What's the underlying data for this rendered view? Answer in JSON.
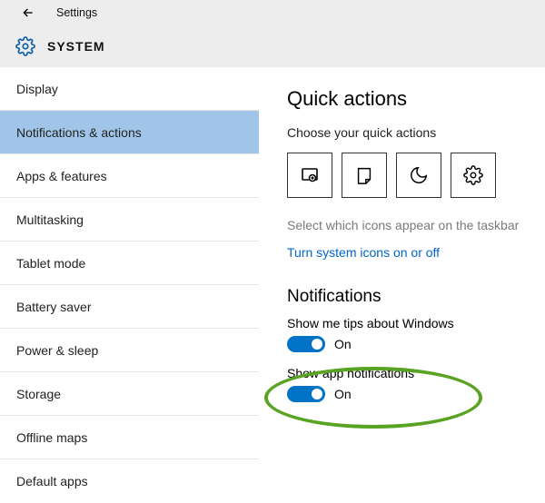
{
  "header": {
    "app_title": "Settings",
    "section_title": "SYSTEM"
  },
  "sidebar": {
    "items": [
      {
        "label": "Display",
        "selected": false
      },
      {
        "label": "Notifications & actions",
        "selected": true
      },
      {
        "label": "Apps & features",
        "selected": false
      },
      {
        "label": "Multitasking",
        "selected": false
      },
      {
        "label": "Tablet mode",
        "selected": false
      },
      {
        "label": "Battery saver",
        "selected": false
      },
      {
        "label": "Power & sleep",
        "selected": false
      },
      {
        "label": "Storage",
        "selected": false
      },
      {
        "label": "Offline maps",
        "selected": false
      },
      {
        "label": "Default apps",
        "selected": false
      }
    ]
  },
  "content": {
    "quick_actions": {
      "heading": "Quick actions",
      "subheading": "Choose your quick actions",
      "tiles": [
        "tablet-mode-icon",
        "note-icon",
        "moon-icon",
        "gear-icon"
      ],
      "taskbar_hint": "Select which icons appear on the taskbar",
      "system_icons_link": "Turn system icons on or off"
    },
    "notifications": {
      "heading": "Notifications",
      "tips": {
        "label": "Show me tips about Windows",
        "state": "On",
        "on": true
      },
      "app_notifs": {
        "label": "Show app notifications",
        "state": "On",
        "on": true
      }
    }
  }
}
